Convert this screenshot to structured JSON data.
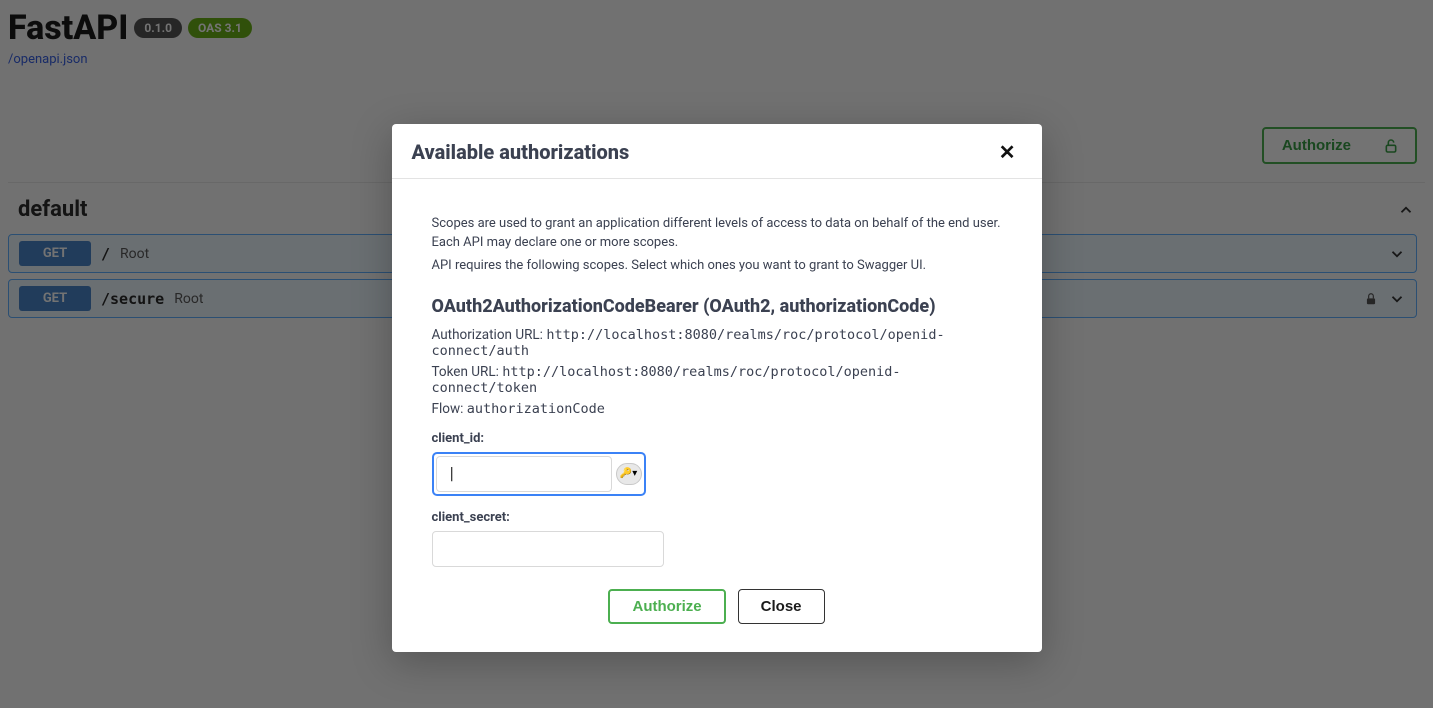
{
  "header": {
    "title": "FastAPI",
    "version_badge": "0.1.0",
    "oas_badge": "OAS 3.1",
    "spec_link": "/openapi.json"
  },
  "authorize_top": {
    "label": "Authorize"
  },
  "section": {
    "name": "default"
  },
  "operations": [
    {
      "method": "GET",
      "path": "/",
      "summary": "Root",
      "locked": false
    },
    {
      "method": "GET",
      "path": "/secure",
      "summary": "Root",
      "locked": true
    }
  ],
  "modal": {
    "title": "Available authorizations",
    "desc1": "Scopes are used to grant an application different levels of access to data on behalf of the end user. Each API may declare one or more scopes.",
    "desc2": "API requires the following scopes. Select which ones you want to grant to Swagger UI.",
    "auth_name": "OAuth2AuthorizationCodeBearer (OAuth2, authorizationCode)",
    "authorization_url_label": "Authorization URL:",
    "authorization_url": "http://localhost:8080/realms/roc/protocol/openid-connect/auth",
    "token_url_label": "Token URL:",
    "token_url": "http://localhost:8080/realms/roc/protocol/openid-connect/token",
    "flow_label": "Flow:",
    "flow": "authorizationCode",
    "client_id_label": "client_id:",
    "client_id_value": "",
    "client_secret_label": "client_secret:",
    "client_secret_value": "",
    "authorize_label": "Authorize",
    "close_label": "Close"
  }
}
